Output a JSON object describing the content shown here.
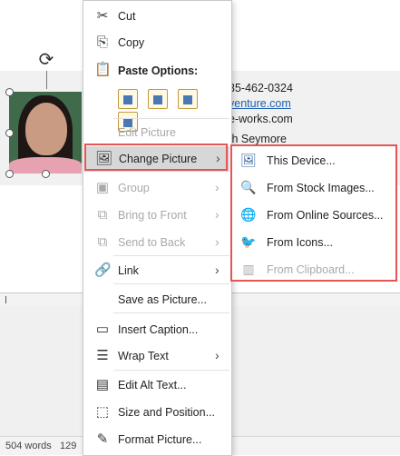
{
  "document": {
    "contact_lines": [
      "35-462-0324",
      "venture.com",
      "e-works.com",
      "th Seymore"
    ]
  },
  "status_bar": {
    "word_count": "504 words",
    "extra": "129"
  },
  "context_menu": {
    "items": [
      {
        "label": "Cut",
        "icon": "scissors-icon",
        "disabled": false
      },
      {
        "label": "Copy",
        "icon": "copy-icon",
        "disabled": false
      },
      {
        "label": "Paste Options:",
        "icon": "clipboard-icon",
        "disabled": false
      },
      {
        "label": "Edit Picture",
        "icon": "",
        "disabled": true
      },
      {
        "label": "Change Picture",
        "icon": "change-picture-icon",
        "disabled": false,
        "submenu": true,
        "highlighted": true
      },
      {
        "label": "Group",
        "icon": "group-icon",
        "disabled": true,
        "submenu": true
      },
      {
        "label": "Bring to Front",
        "icon": "bring-to-front-icon",
        "disabled": true,
        "submenu": true
      },
      {
        "label": "Send to Back",
        "icon": "send-to-back-icon",
        "disabled": true,
        "submenu": true
      },
      {
        "label": "Link",
        "icon": "link-icon",
        "disabled": false,
        "submenu": true
      },
      {
        "label": "Save as Picture...",
        "icon": "",
        "disabled": false
      },
      {
        "label": "Insert Caption...",
        "icon": "insert-caption-icon",
        "disabled": false
      },
      {
        "label": "Wrap Text",
        "icon": "wrap-text-icon",
        "disabled": false,
        "submenu": true
      },
      {
        "label": "Edit Alt Text...",
        "icon": "alt-text-icon",
        "disabled": false
      },
      {
        "label": "Size and Position...",
        "icon": "size-position-icon",
        "disabled": false
      },
      {
        "label": "Format Picture...",
        "icon": "format-picture-icon",
        "disabled": false
      }
    ]
  },
  "change_picture_submenu": {
    "items": [
      {
        "label": "This Device...",
        "icon": "device-icon",
        "disabled": false
      },
      {
        "label": "From Stock Images...",
        "icon": "stock-images-icon",
        "disabled": false
      },
      {
        "label": "From Online Sources...",
        "icon": "online-sources-icon",
        "disabled": false
      },
      {
        "label": "From Icons...",
        "icon": "icons-icon",
        "disabled": false
      },
      {
        "label": "From Clipboard...",
        "icon": "clipboard-picture-icon",
        "disabled": true
      }
    ]
  },
  "colors": {
    "highlight_outline": "#e25656",
    "link": "#1a5fb4",
    "menu_hover": "#d7d7d7"
  }
}
